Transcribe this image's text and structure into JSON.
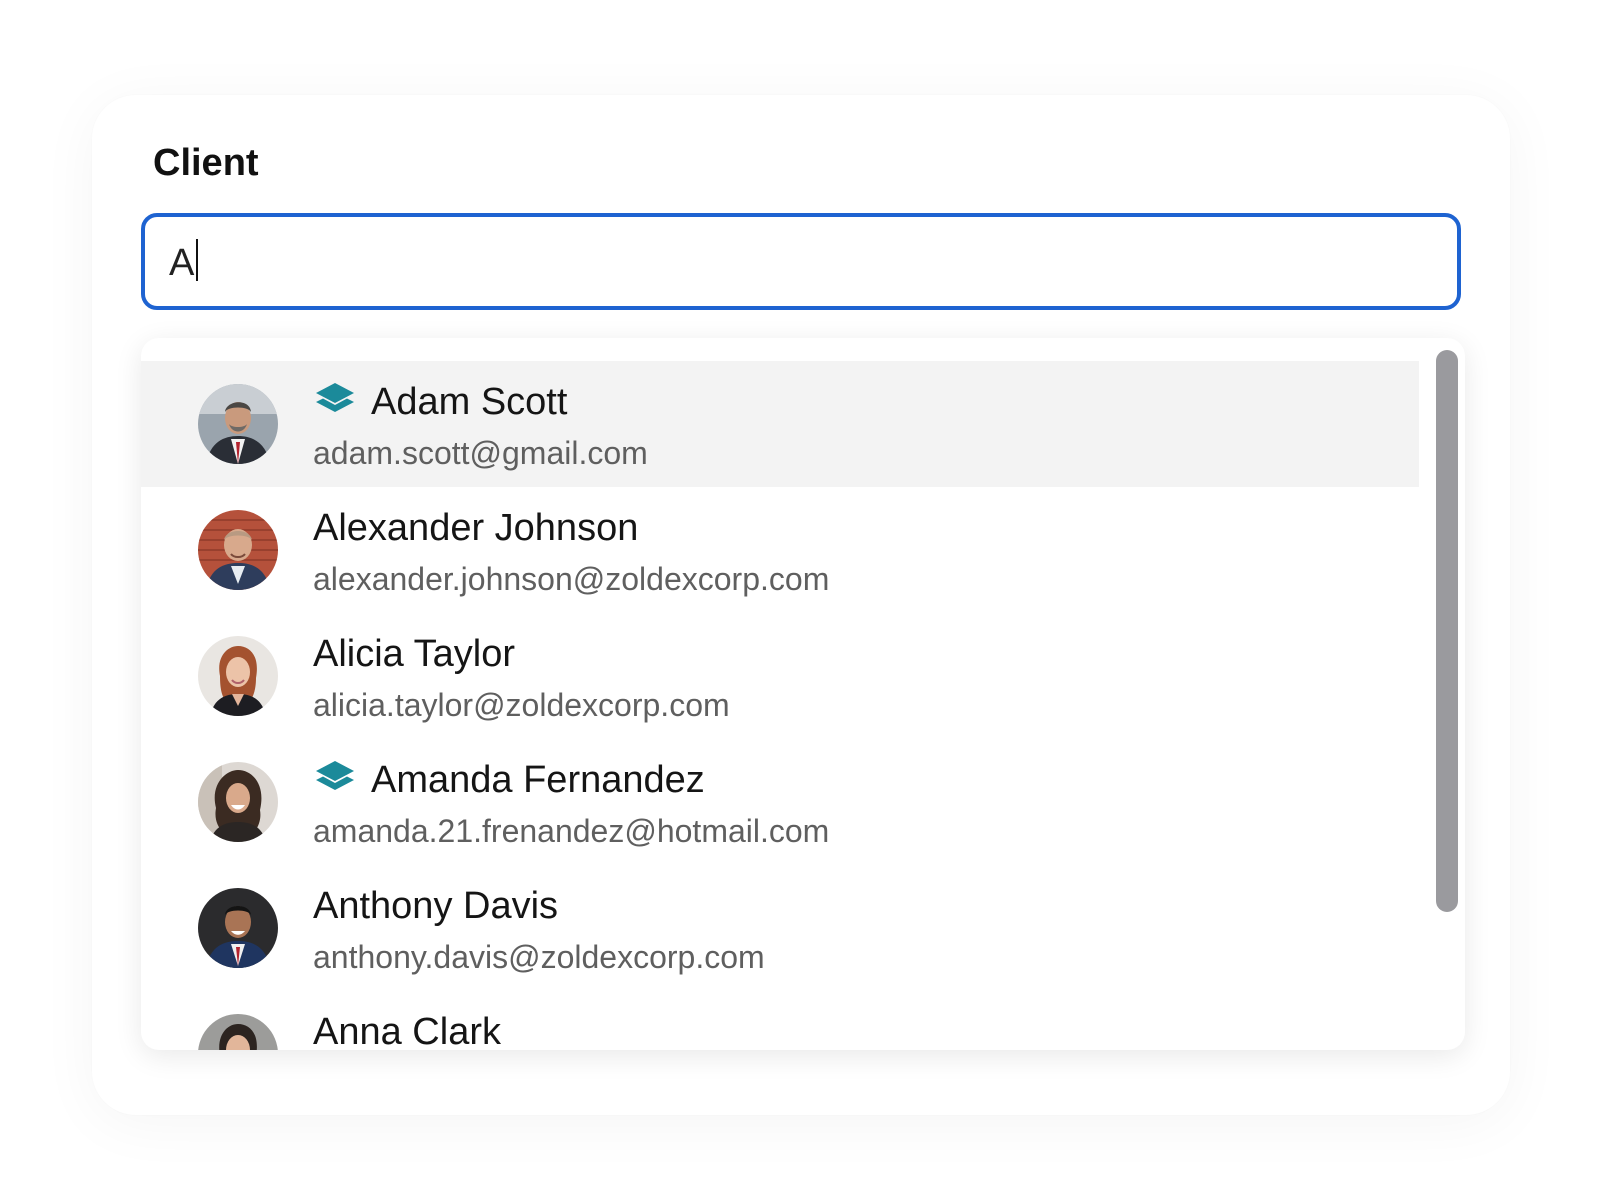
{
  "form": {
    "label": "Client",
    "search_value": "A"
  },
  "clients": [
    {
      "name": "Adam Scott",
      "email": "adam.scott@gmail.com",
      "has_badge": true,
      "badge_icon": "stack-layers-icon",
      "highlighted": true
    },
    {
      "name": "Alexander Johnson",
      "email": "alexander.johnson@zoldexcorp.com",
      "has_badge": false,
      "highlighted": false
    },
    {
      "name": "Alicia Taylor",
      "email": "alicia.taylor@zoldexcorp.com",
      "has_badge": false,
      "highlighted": false
    },
    {
      "name": "Amanda Fernandez",
      "email": "amanda.21.frenandez@hotmail.com",
      "has_badge": true,
      "badge_icon": "stack-layers-icon",
      "highlighted": false
    },
    {
      "name": "Anthony Davis",
      "email": "anthony.davis@zoldexcorp.com",
      "has_badge": false,
      "highlighted": false
    },
    {
      "name": "Anna Clark",
      "email": "",
      "has_badge": false,
      "highlighted": false
    }
  ],
  "colors": {
    "focus_border": "#1e63d1",
    "badge": "#1b8a9a",
    "highlight_row": "#f3f3f3",
    "scrollbar": "#9a9a9e"
  }
}
